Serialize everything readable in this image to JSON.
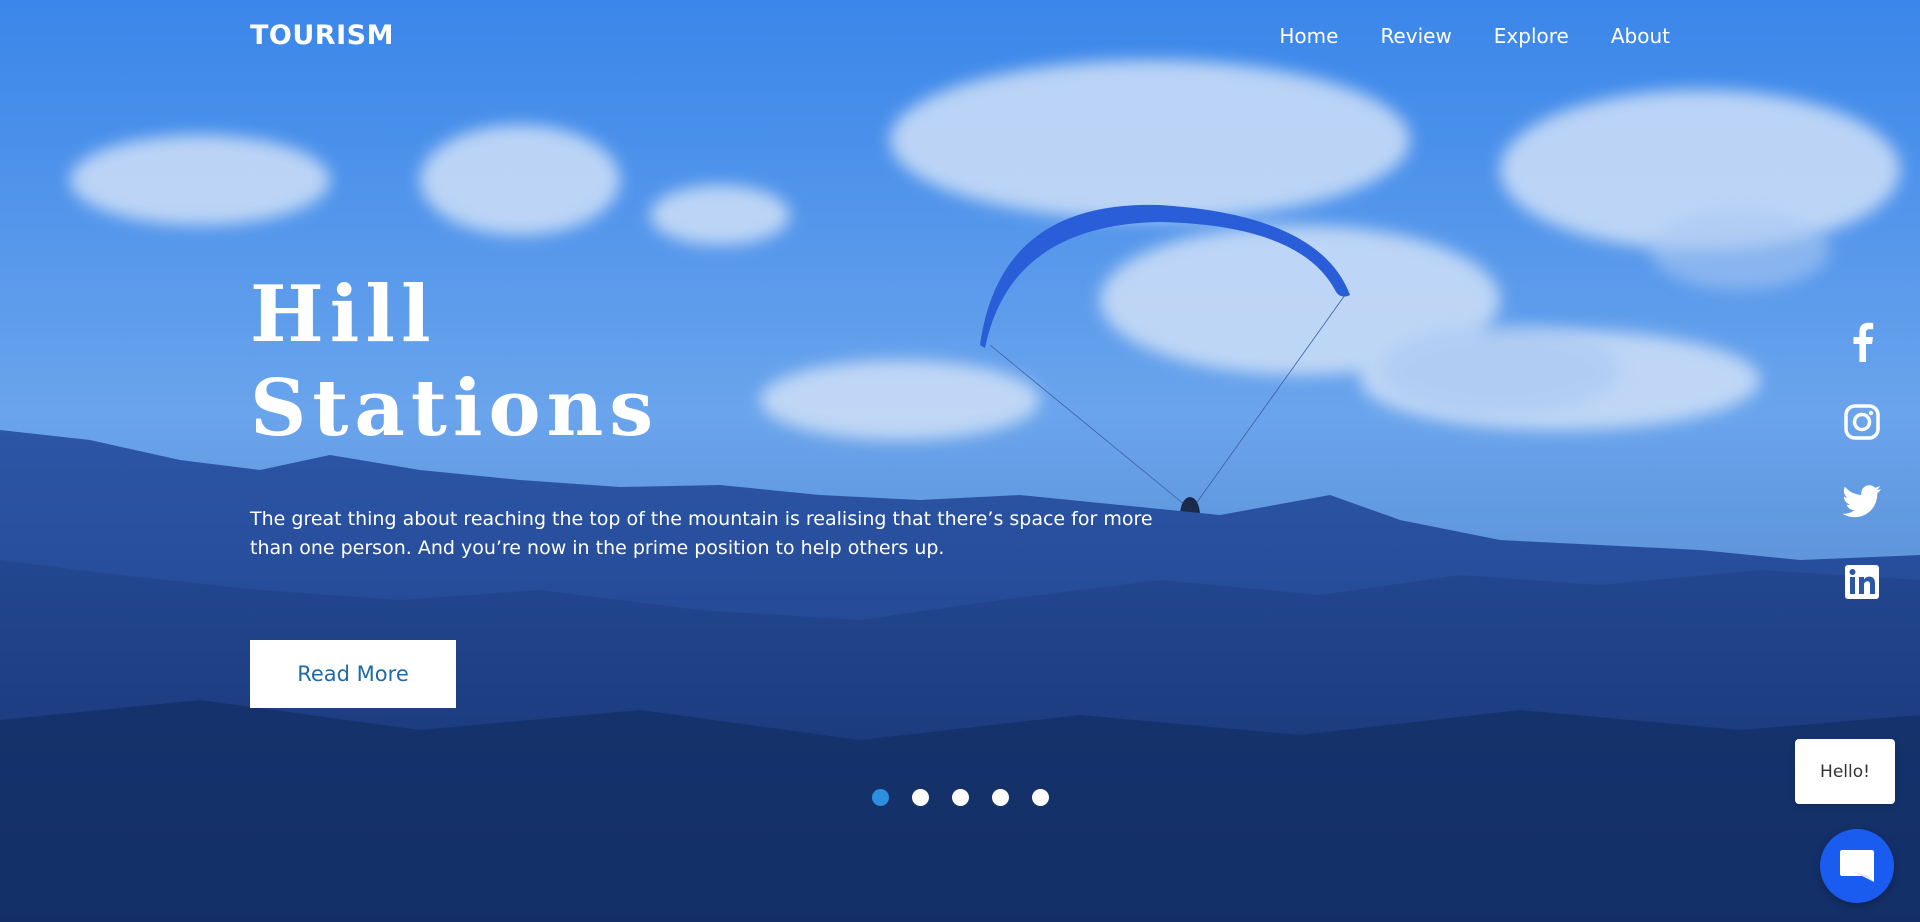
{
  "brand": {
    "logo": "TOURISM"
  },
  "nav": {
    "items": [
      "Home",
      "Review",
      "Explore",
      "About"
    ]
  },
  "hero": {
    "title_line1": "Hill",
    "title_line2": "Stations",
    "description_line1": "The great thing about reaching the top of the mountain is realising that there’s space for more",
    "description_line2": "than one person. And you’re now in the prime position to help others up.",
    "cta_label": "Read More"
  },
  "carousel": {
    "slide_count": 5,
    "active_index": 0
  },
  "social": {
    "icons": [
      "facebook-icon",
      "instagram-icon",
      "twitter-icon",
      "linkedin-icon"
    ]
  },
  "chat": {
    "bubble_text": "Hello!",
    "icon": "chat-icon"
  },
  "colors": {
    "overlay_blue": "#2f6fd0",
    "cta_text": "#1f6aa8",
    "active_dot": "#2d8fe0",
    "chat_button": "#1b5cf0"
  }
}
